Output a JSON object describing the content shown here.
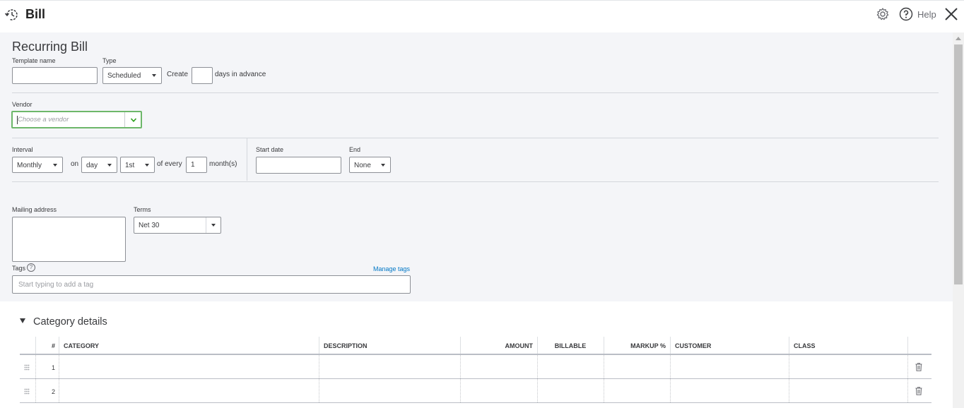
{
  "header": {
    "title": "Bill",
    "help_label": "Help",
    "icons": [
      "recurring-clock-icon",
      "gear-icon",
      "help-circle-icon",
      "close-icon"
    ]
  },
  "form": {
    "page_title": "Recurring Bill",
    "template_name": {
      "label": "Template name",
      "value": ""
    },
    "type": {
      "label": "Type",
      "value": "Scheduled"
    },
    "create": {
      "label": "Create",
      "value": "",
      "suffix": "days in advance"
    },
    "vendor": {
      "label": "Vendor",
      "placeholder": "Choose a vendor"
    },
    "interval": {
      "label": "Interval",
      "frequency": "Monthly",
      "on_label": "on",
      "day_type": "day",
      "day_value": "1st",
      "of_every_label": "of every",
      "every_value": "1",
      "unit_label": "month(s)"
    },
    "start_date": {
      "label": "Start date",
      "value": ""
    },
    "end": {
      "label": "End",
      "value": "None"
    },
    "mailing_address": {
      "label": "Mailing address",
      "value": ""
    },
    "terms": {
      "label": "Terms",
      "value": "Net 30"
    },
    "tags": {
      "label": "Tags",
      "help_glyph": "?",
      "manage_label": "Manage tags",
      "placeholder": "Start typing to add a tag"
    }
  },
  "category_details": {
    "title": "Category details",
    "columns": [
      "#",
      "CATEGORY",
      "DESCRIPTION",
      "AMOUNT",
      "BILLABLE",
      "MARKUP %",
      "CUSTOMER",
      "CLASS"
    ],
    "rows": [
      {
        "num": "1"
      },
      {
        "num": "2"
      }
    ]
  },
  "colors": {
    "accent_green": "#6db76a",
    "link_blue": "#0077c5",
    "form_bg": "#f4f5f8"
  }
}
